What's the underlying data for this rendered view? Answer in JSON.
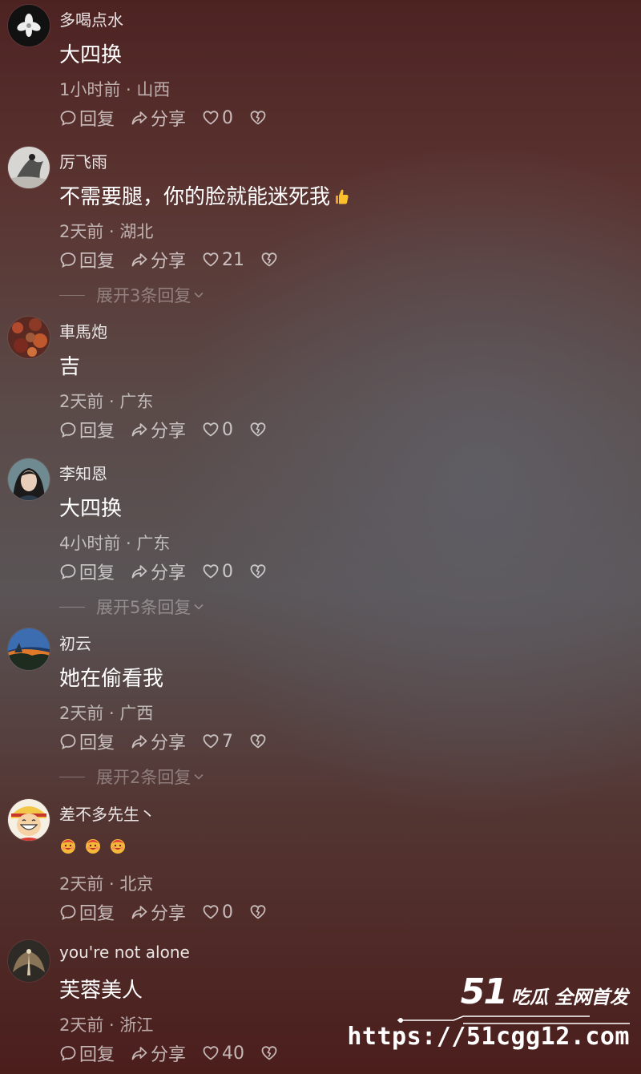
{
  "labels": {
    "reply": "回复",
    "share": "分享"
  },
  "comments": [
    {
      "user": "多喝点水",
      "text": "大四换",
      "time": "1小时前",
      "location": "山西",
      "likes": "0",
      "avatar_icon": "avatar-white-flower"
    },
    {
      "user": "厉飞雨",
      "text": "不需要腿，你的脸就能迷死我",
      "time": "2天前",
      "location": "湖北",
      "likes": "21",
      "expand": "展开3条回复",
      "avatar_icon": "avatar-ink-figure",
      "trailing_emoji": "thumbs-up"
    },
    {
      "user": "車馬炮",
      "text": "吉",
      "time": "2天前",
      "location": "广东",
      "likes": "0",
      "avatar_icon": "avatar-autumn-leaves"
    },
    {
      "user": "李知恩",
      "text": "大四换",
      "time": "4小时前",
      "location": "广东",
      "likes": "0",
      "expand": "展开5条回复",
      "avatar_icon": "avatar-girl-portrait"
    },
    {
      "user": "初云",
      "text": "她在偷看我",
      "time": "2天前",
      "location": "广西",
      "likes": "7",
      "expand": "展开2条回复",
      "avatar_icon": "avatar-sunset-landscape"
    },
    {
      "user": "差不多先生丶",
      "text": "",
      "emojis": [
        "smiling-face-emoji",
        "smiling-face-emoji",
        "smiling-face-emoji"
      ],
      "time": "2天前",
      "location": "北京",
      "likes": "0",
      "avatar_icon": "avatar-cartoon-boy"
    },
    {
      "user": "you're not alone",
      "text": "芙蓉美人",
      "time": "2天前",
      "location": "浙江",
      "likes": "40",
      "avatar_icon": "avatar-dark-wings"
    }
  ],
  "watermark": {
    "brand": "51",
    "slogan": "吃瓜 全网首发",
    "url": "https://51cgg12.com"
  }
}
